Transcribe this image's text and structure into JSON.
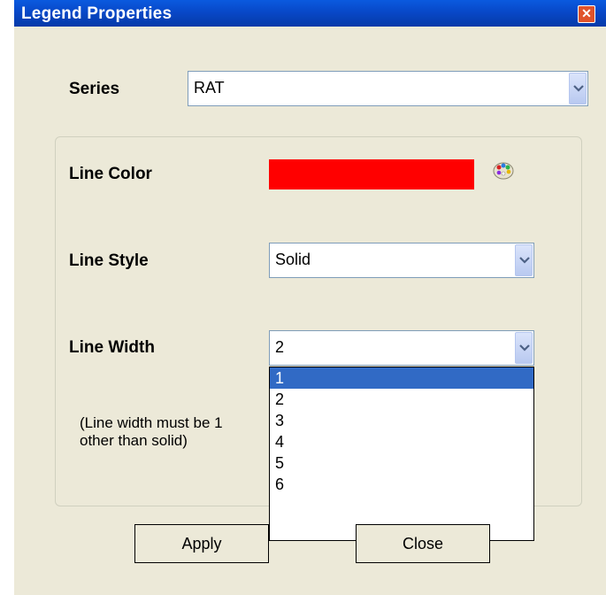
{
  "window": {
    "title": "Legend Properties",
    "close_glyph": "✕"
  },
  "series": {
    "label": "Series",
    "value": "RAT"
  },
  "line_color": {
    "label": "Line Color",
    "color": "#ff0000",
    "icon": "palette-icon"
  },
  "line_style": {
    "label": "Line Style",
    "value": "Solid"
  },
  "line_width": {
    "label": "Line Width",
    "value": "2",
    "options": [
      "1",
      "2",
      "3",
      "4",
      "5",
      "6"
    ],
    "highlighted": "1"
  },
  "note": {
    "line1": "(Line width must be 1",
    "line2": "other than solid)"
  },
  "buttons": {
    "apply": "Apply",
    "close": "Close"
  }
}
